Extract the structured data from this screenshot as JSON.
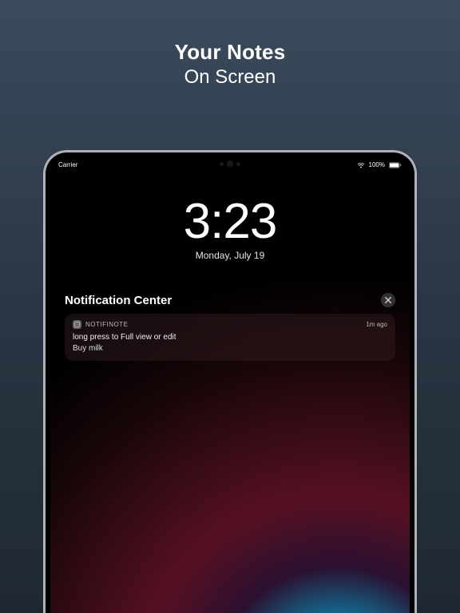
{
  "headline": {
    "title": "Your Notes",
    "subtitle": "On Screen"
  },
  "statusBar": {
    "carrier": "Carrier",
    "battery": "100%"
  },
  "lockScreen": {
    "time": "3:23",
    "date": "Monday, July 19"
  },
  "notificationCenter": {
    "title": "Notification Center",
    "notification": {
      "appName": "NOTIFINOTE",
      "timeAgo": "1m ago",
      "title": "long press to Full view or edit",
      "body": "Buy milk"
    }
  }
}
